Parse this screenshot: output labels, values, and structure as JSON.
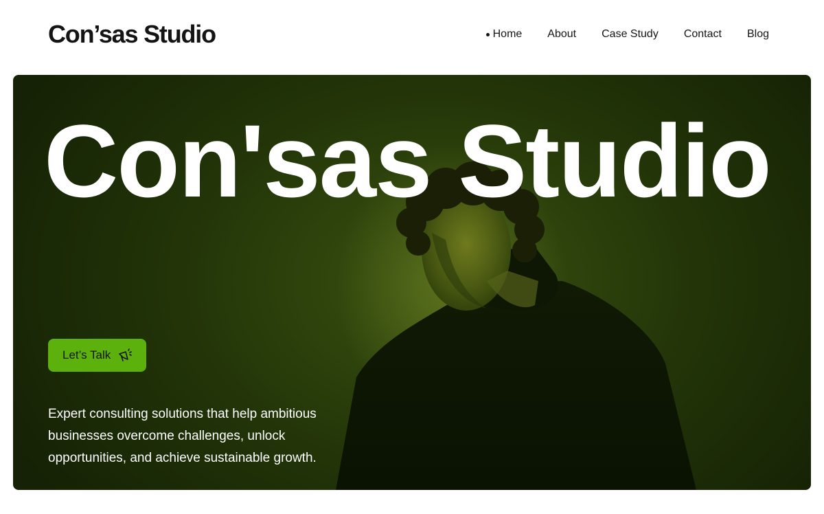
{
  "header": {
    "logo": "Con’sas Studio",
    "nav": [
      {
        "label": "Home",
        "active": true
      },
      {
        "label": "About"
      },
      {
        "label": "Case Study"
      },
      {
        "label": "Contact"
      },
      {
        "label": "Blog"
      }
    ]
  },
  "hero": {
    "title": "Con'sas Studio",
    "cta_label": "Let’s Talk",
    "cta_icon": "megaphone-icon",
    "description": "Expert consulting solutions that help ambitious businesses overcome challenges, unlock opportunities, and achieve sustainable growth."
  },
  "colors": {
    "accent": "#5cb10c",
    "hero_bg": "#223408",
    "text_dark": "#141414"
  }
}
